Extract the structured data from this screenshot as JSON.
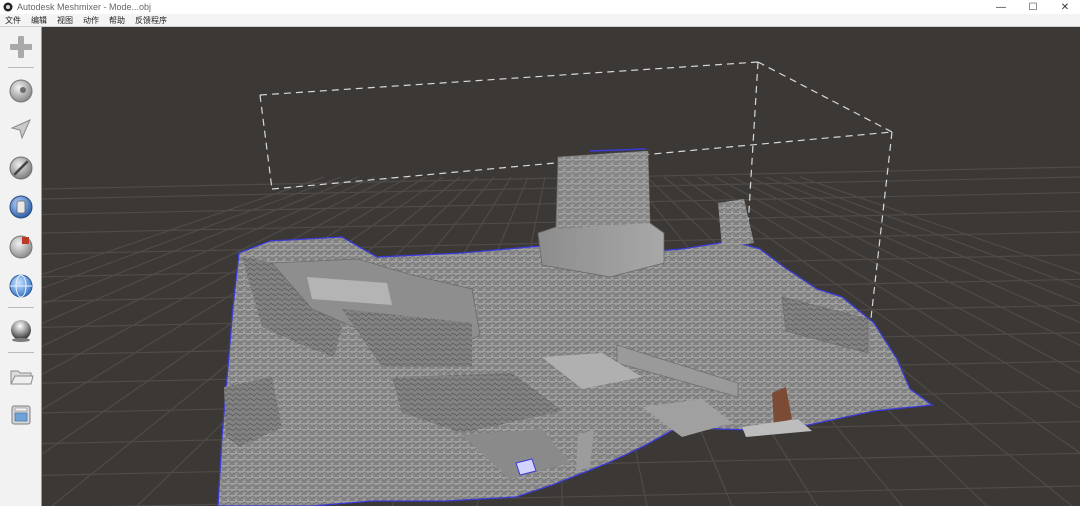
{
  "window": {
    "title": "Autodesk Meshmixer - Mode...obj",
    "controls": {
      "minimize": "—",
      "maximize": "☐",
      "close": "✕"
    }
  },
  "menu": {
    "items": [
      {
        "label": "文件"
      },
      {
        "label": "编辑"
      },
      {
        "label": "视图"
      },
      {
        "label": "动作"
      },
      {
        "label": "帮助"
      },
      {
        "label": "反馈程序"
      }
    ]
  },
  "toolbar": {
    "icons": [
      "import-plus-icon",
      "meshmix-sphere-icon",
      "select-arrow-icon",
      "sculpt-brush-icon",
      "edit-globe-icon",
      "analysis-sphere-icon",
      "shaders-globe-icon",
      "export-ball-icon",
      "open-folder-icon",
      "print-icon"
    ]
  },
  "viewport": {
    "background_color": "#3b3836",
    "grid_color": "#4f4b48",
    "mesh_color": "#9a9a9a",
    "outline_color": "#3030d0",
    "bounds_box": "dashed"
  }
}
